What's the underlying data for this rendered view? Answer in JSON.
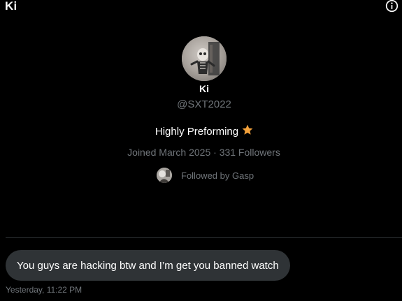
{
  "header": {
    "title": "Ki",
    "info_icon": "info-circle-icon"
  },
  "profile": {
    "display_name": "Ki",
    "handle": "@SXT2022",
    "bio": "Highly Preforming",
    "bio_emoji": "star-icon",
    "joined": "Joined March 2025",
    "separator": "·",
    "followers": "331 Followers",
    "followed_by": "Followed by Gasp"
  },
  "messages": [
    {
      "text": "You guys are hacking btw and I’m get you banned watch",
      "timestamp": "Yesterday, 11:22 PM"
    }
  ],
  "colors": {
    "background": "#000000",
    "text_primary": "#ffffff",
    "text_secondary": "#71767b",
    "bubble_bg": "#2f3336",
    "divider": "#2f3336",
    "star": "#f4a23b"
  }
}
